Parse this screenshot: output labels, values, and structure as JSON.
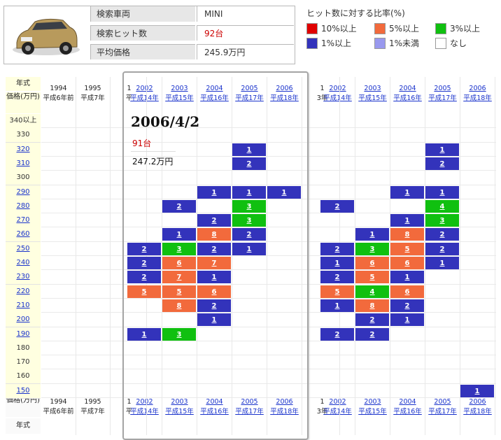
{
  "search_info": {
    "vehicle_label": "検索車両",
    "vehicle_value": "MINI",
    "hits_label": "検索ヒット数",
    "hits_value": "92台",
    "avg_price_label": "平均価格",
    "avg_price_value": "245.9万円"
  },
  "legend": {
    "title": "ヒット数に対する比率(%)",
    "items": [
      {
        "label": "10%以上",
        "color": "#e00000"
      },
      {
        "label": "5%以上",
        "color": "#f26a3c"
      },
      {
        "label": "3%以上",
        "color": "#10c010"
      },
      {
        "label": "1%以上",
        "color": "#3333bb"
      },
      {
        "label": "1%未満",
        "color": "#9999ee"
      },
      {
        "label": "なし",
        "color": "#ffffff"
      }
    ]
  },
  "grid": {
    "year_header": "年式",
    "price_header": "価格(万円)",
    "price_footer": "価格(万円)",
    "year_footer": "年式",
    "year_columns": [
      {
        "year": "1994",
        "era": "平成6年前",
        "linked": false
      },
      {
        "year": "1995",
        "era": "平成7年",
        "linked": false
      },
      {
        "year": "1",
        "era": "平",
        "linked": false
      },
      {
        "year": "2002",
        "era": "平成14年",
        "linked": true
      },
      {
        "year": "2003",
        "era": "平成15年",
        "linked": true
      },
      {
        "year": "2004",
        "era": "平成16年",
        "linked": true
      },
      {
        "year": "2005",
        "era": "平成17年",
        "linked": true
      },
      {
        "year": "2006",
        "era": "平成18年",
        "linked": true
      },
      {
        "year": "1",
        "era": "3年",
        "linked": false
      },
      {
        "year": "2002",
        "era": "平成14年",
        "linked": true
      },
      {
        "year": "2003",
        "era": "平成15年",
        "linked": true
      },
      {
        "year": "2004",
        "era": "平成16年",
        "linked": true
      },
      {
        "year": "2005",
        "era": "平成17年",
        "linked": true
      },
      {
        "year": "2006",
        "era": "平成18年",
        "linked": true
      }
    ],
    "price_rows": [
      {
        "label": "340以上",
        "linked": false
      },
      {
        "label": "330",
        "linked": false
      },
      {
        "label": "320",
        "linked": true
      },
      {
        "label": "310",
        "linked": true
      },
      {
        "label": "300",
        "linked": false
      },
      {
        "label": "290",
        "linked": true
      },
      {
        "label": "280",
        "linked": true
      },
      {
        "label": "270",
        "linked": true
      },
      {
        "label": "260",
        "linked": true
      },
      {
        "label": "250",
        "linked": true
      },
      {
        "label": "240",
        "linked": true
      },
      {
        "label": "230",
        "linked": true
      },
      {
        "label": "220",
        "linked": true
      },
      {
        "label": "210",
        "linked": true
      },
      {
        "label": "200",
        "linked": true
      },
      {
        "label": "190",
        "linked": true
      },
      {
        "label": "180",
        "linked": false
      },
      {
        "label": "170",
        "linked": false
      },
      {
        "label": "160",
        "linked": false
      },
      {
        "label": "150",
        "linked": true
      }
    ],
    "popup_marks": [
      {
        "row": 2,
        "col": 3,
        "count": "1",
        "level": "1pct"
      },
      {
        "row": 3,
        "col": 3,
        "count": "2",
        "level": "1pct"
      },
      {
        "row": 5,
        "col": 2,
        "count": "1",
        "level": "1pct"
      },
      {
        "row": 5,
        "col": 3,
        "count": "1",
        "level": "1pct"
      },
      {
        "row": 5,
        "col": 4,
        "count": "1",
        "level": "1pct"
      },
      {
        "row": 6,
        "col": 1,
        "count": "2",
        "level": "1pct"
      },
      {
        "row": 6,
        "col": 3,
        "count": "3",
        "level": "3pct"
      },
      {
        "row": 7,
        "col": 2,
        "count": "2",
        "level": "1pct"
      },
      {
        "row": 7,
        "col": 3,
        "count": "3",
        "level": "3pct"
      },
      {
        "row": 8,
        "col": 1,
        "count": "1",
        "level": "1pct"
      },
      {
        "row": 8,
        "col": 2,
        "count": "8",
        "level": "5pct"
      },
      {
        "row": 8,
        "col": 3,
        "count": "2",
        "level": "1pct"
      },
      {
        "row": 9,
        "col": 0,
        "count": "2",
        "level": "1pct"
      },
      {
        "row": 9,
        "col": 1,
        "count": "3",
        "level": "3pct"
      },
      {
        "row": 9,
        "col": 2,
        "count": "2",
        "level": "1pct"
      },
      {
        "row": 9,
        "col": 3,
        "count": "1",
        "level": "1pct"
      },
      {
        "row": 10,
        "col": 0,
        "count": "2",
        "level": "1pct"
      },
      {
        "row": 10,
        "col": 1,
        "count": "6",
        "level": "5pct"
      },
      {
        "row": 10,
        "col": 2,
        "count": "7",
        "level": "5pct"
      },
      {
        "row": 11,
        "col": 0,
        "count": "2",
        "level": "1pct"
      },
      {
        "row": 11,
        "col": 1,
        "count": "7",
        "level": "5pct"
      },
      {
        "row": 11,
        "col": 2,
        "count": "1",
        "level": "1pct"
      },
      {
        "row": 12,
        "col": 0,
        "count": "5",
        "level": "5pct"
      },
      {
        "row": 12,
        "col": 1,
        "count": "5",
        "level": "5pct"
      },
      {
        "row": 12,
        "col": 2,
        "count": "6",
        "level": "5pct"
      },
      {
        "row": 13,
        "col": 1,
        "count": "8",
        "level": "5pct"
      },
      {
        "row": 13,
        "col": 2,
        "count": "2",
        "level": "1pct"
      },
      {
        "row": 14,
        "col": 2,
        "count": "1",
        "level": "1pct"
      },
      {
        "row": 15,
        "col": 0,
        "count": "1",
        "level": "1pct"
      },
      {
        "row": 15,
        "col": 1,
        "count": "3",
        "level": "3pct"
      }
    ],
    "main_marks": [
      {
        "row": 2,
        "col": 4,
        "count": "1",
        "level": "1pct"
      },
      {
        "row": 3,
        "col": 4,
        "count": "2",
        "level": "1pct"
      },
      {
        "row": 5,
        "col": 3,
        "count": "1",
        "level": "1pct"
      },
      {
        "row": 5,
        "col": 4,
        "count": "1",
        "level": "1pct"
      },
      {
        "row": 6,
        "col": 1,
        "count": "2",
        "level": "1pct"
      },
      {
        "row": 6,
        "col": 4,
        "count": "4",
        "level": "3pct"
      },
      {
        "row": 7,
        "col": 3,
        "count": "1",
        "level": "1pct"
      },
      {
        "row": 7,
        "col": 4,
        "count": "3",
        "level": "3pct"
      },
      {
        "row": 8,
        "col": 2,
        "count": "1",
        "level": "1pct"
      },
      {
        "row": 8,
        "col": 3,
        "count": "8",
        "level": "5pct"
      },
      {
        "row": 8,
        "col": 4,
        "count": "2",
        "level": "1pct"
      },
      {
        "row": 9,
        "col": 1,
        "count": "2",
        "level": "1pct"
      },
      {
        "row": 9,
        "col": 2,
        "count": "3",
        "level": "3pct"
      },
      {
        "row": 9,
        "col": 3,
        "count": "5",
        "level": "5pct"
      },
      {
        "row": 9,
        "col": 4,
        "count": "2",
        "level": "1pct"
      },
      {
        "row": 10,
        "col": 1,
        "count": "1",
        "level": "1pct"
      },
      {
        "row": 10,
        "col": 2,
        "count": "6",
        "level": "5pct"
      },
      {
        "row": 10,
        "col": 3,
        "count": "6",
        "level": "5pct"
      },
      {
        "row": 10,
        "col": 4,
        "count": "1",
        "level": "1pct"
      },
      {
        "row": 11,
        "col": 1,
        "count": "2",
        "level": "1pct"
      },
      {
        "row": 11,
        "col": 2,
        "count": "5",
        "level": "5pct"
      },
      {
        "row": 11,
        "col": 3,
        "count": "1",
        "level": "1pct"
      },
      {
        "row": 12,
        "col": 1,
        "count": "5",
        "level": "5pct"
      },
      {
        "row": 12,
        "col": 2,
        "count": "4",
        "level": "3pct"
      },
      {
        "row": 12,
        "col": 3,
        "count": "6",
        "level": "5pct"
      },
      {
        "row": 13,
        "col": 1,
        "count": "1",
        "level": "1pct"
      },
      {
        "row": 13,
        "col": 2,
        "count": "8",
        "level": "5pct"
      },
      {
        "row": 13,
        "col": 3,
        "count": "2",
        "level": "1pct"
      },
      {
        "row": 14,
        "col": 2,
        "count": "2",
        "level": "1pct"
      },
      {
        "row": 14,
        "col": 3,
        "count": "1",
        "level": "1pct"
      },
      {
        "row": 15,
        "col": 1,
        "count": "2",
        "level": "1pct"
      },
      {
        "row": 15,
        "col": 2,
        "count": "2",
        "level": "1pct"
      },
      {
        "row": 19,
        "col": 5,
        "count": "1",
        "level": "1pct"
      }
    ],
    "level_colors": {
      "1pct": "#3333bb",
      "3pct": "#10c010",
      "5pct": "#f26a3c"
    }
  },
  "popup": {
    "date": "2006/4/2",
    "count": "91台",
    "avg_price": "247.2万円"
  }
}
